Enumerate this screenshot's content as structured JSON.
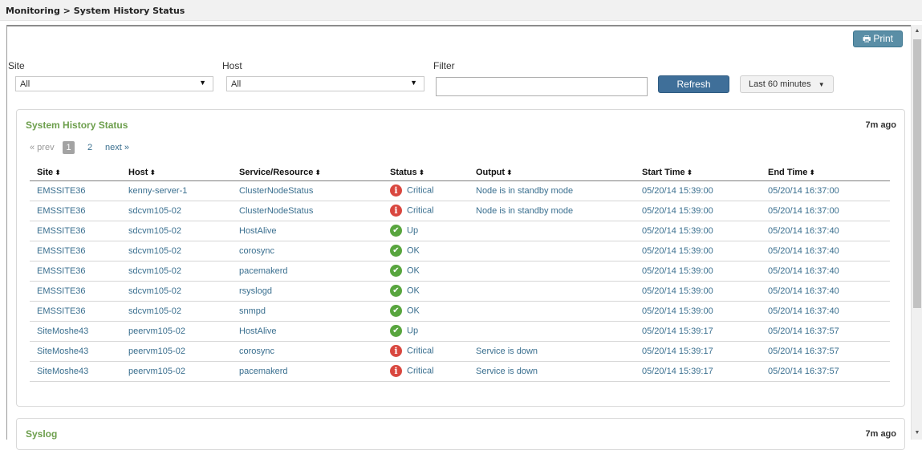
{
  "breadcrumb": "Monitoring > System History Status",
  "toolbar": {
    "print_label": "Print"
  },
  "filters": {
    "site_label": "Site",
    "site_value": "All",
    "host_label": "Host",
    "host_value": "All",
    "filter_label": "Filter",
    "filter_value": "",
    "refresh_label": "Refresh",
    "range_label": "Last 60 minutes"
  },
  "panel": {
    "title": "System History Status",
    "ago": "7m ago",
    "pager": {
      "prev": "« prev",
      "current": "1",
      "page2": "2",
      "next": "next »"
    },
    "columns": [
      "Site",
      "Host",
      "Service/Resource",
      "Status",
      "Output",
      "Start Time",
      "End Time"
    ],
    "rows": [
      {
        "site": "EMSSITE36",
        "host": "kenny-server-1",
        "service": "ClusterNodeStatus",
        "status": "Critical",
        "status_icon": "critical-icon",
        "output": "Node is in standby mode",
        "start": "05/20/14 15:39:00",
        "end": "05/20/14 16:37:00"
      },
      {
        "site": "EMSSITE36",
        "host": "sdcvm105-02",
        "service": "ClusterNodeStatus",
        "status": "Critical",
        "status_icon": "critical-icon",
        "output": "Node is in standby mode",
        "start": "05/20/14 15:39:00",
        "end": "05/20/14 16:37:00"
      },
      {
        "site": "EMSSITE36",
        "host": "sdcvm105-02",
        "service": "HostAlive",
        "status": "Up",
        "status_icon": "check-icon",
        "output": "",
        "start": "05/20/14 15:39:00",
        "end": "05/20/14 16:37:40"
      },
      {
        "site": "EMSSITE36",
        "host": "sdcvm105-02",
        "service": "corosync",
        "status": "OK",
        "status_icon": "check-icon",
        "output": "",
        "start": "05/20/14 15:39:00",
        "end": "05/20/14 16:37:40"
      },
      {
        "site": "EMSSITE36",
        "host": "sdcvm105-02",
        "service": "pacemakerd",
        "status": "OK",
        "status_icon": "check-icon",
        "output": "",
        "start": "05/20/14 15:39:00",
        "end": "05/20/14 16:37:40"
      },
      {
        "site": "EMSSITE36",
        "host": "sdcvm105-02",
        "service": "rsyslogd",
        "status": "OK",
        "status_icon": "check-icon",
        "output": "",
        "start": "05/20/14 15:39:00",
        "end": "05/20/14 16:37:40"
      },
      {
        "site": "EMSSITE36",
        "host": "sdcvm105-02",
        "service": "snmpd",
        "status": "OK",
        "status_icon": "check-icon",
        "output": "",
        "start": "05/20/14 15:39:00",
        "end": "05/20/14 16:37:40"
      },
      {
        "site": "SiteMoshe43",
        "host": "peervm105-02",
        "service": "HostAlive",
        "status": "Up",
        "status_icon": "check-icon",
        "output": "",
        "start": "05/20/14 15:39:17",
        "end": "05/20/14 16:37:57"
      },
      {
        "site": "SiteMoshe43",
        "host": "peervm105-02",
        "service": "corosync",
        "status": "Critical",
        "status_icon": "critical-icon",
        "output": "Service is down",
        "start": "05/20/14 15:39:17",
        "end": "05/20/14 16:37:57"
      },
      {
        "site": "SiteMoshe43",
        "host": "peervm105-02",
        "service": "pacemakerd",
        "status": "Critical",
        "status_icon": "critical-icon",
        "output": "Service is down",
        "start": "05/20/14 15:39:17",
        "end": "05/20/14 16:37:57"
      }
    ]
  },
  "syslog": {
    "title": "Syslog",
    "ago": "7m ago"
  },
  "colors": {
    "accent_green": "#6d9f4d",
    "link_blue": "#3a6f8f",
    "critical_red": "#d9473f",
    "ok_green": "#58a53e",
    "refresh_blue": "#3f6f99"
  }
}
